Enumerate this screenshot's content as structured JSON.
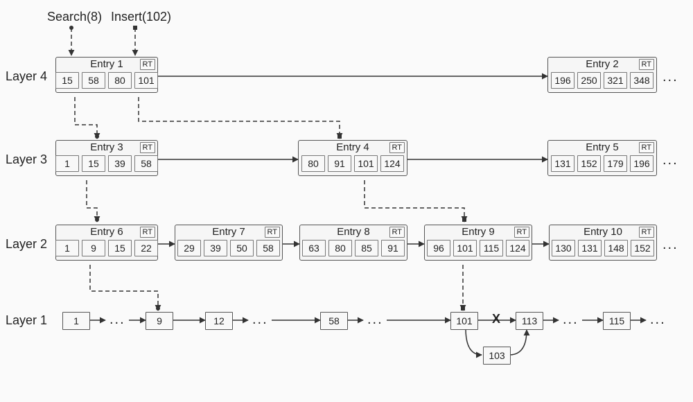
{
  "ops": {
    "search": "Search(8)",
    "insert": "Insert(102)"
  },
  "layers": {
    "l4": "Layer 4",
    "l3": "Layer 3",
    "l2": "Layer 2",
    "l1": "Layer 1"
  },
  "rt": "RT",
  "entries": {
    "e1": {
      "title": "Entry 1",
      "cells": [
        "15",
        "58",
        "80",
        "101"
      ]
    },
    "e2": {
      "title": "Entry 2",
      "cells": [
        "196",
        "250",
        "321",
        "348"
      ]
    },
    "e3": {
      "title": "Entry 3",
      "cells": [
        "1",
        "15",
        "39",
        "58"
      ]
    },
    "e4": {
      "title": "Entry 4",
      "cells": [
        "80",
        "91",
        "101",
        "124"
      ]
    },
    "e5": {
      "title": "Entry 5",
      "cells": [
        "131",
        "152",
        "179",
        "196"
      ]
    },
    "e6": {
      "title": "Entry 6",
      "cells": [
        "1",
        "9",
        "15",
        "22"
      ]
    },
    "e7": {
      "title": "Entry 7",
      "cells": [
        "29",
        "39",
        "50",
        "58"
      ]
    },
    "e8": {
      "title": "Entry 8",
      "cells": [
        "63",
        "80",
        "85",
        "91"
      ]
    },
    "e9": {
      "title": "Entry 9",
      "cells": [
        "96",
        "101",
        "115",
        "124"
      ]
    },
    "e10": {
      "title": "Entry 10",
      "cells": [
        "130",
        "131",
        "148",
        "152"
      ]
    }
  },
  "layer1": {
    "n1": "1",
    "n9": "9",
    "n12": "12",
    "n58": "58",
    "n101": "101",
    "n113": "113",
    "n115": "115",
    "n103": "103"
  },
  "ellipsis": "...",
  "xmark": "X"
}
